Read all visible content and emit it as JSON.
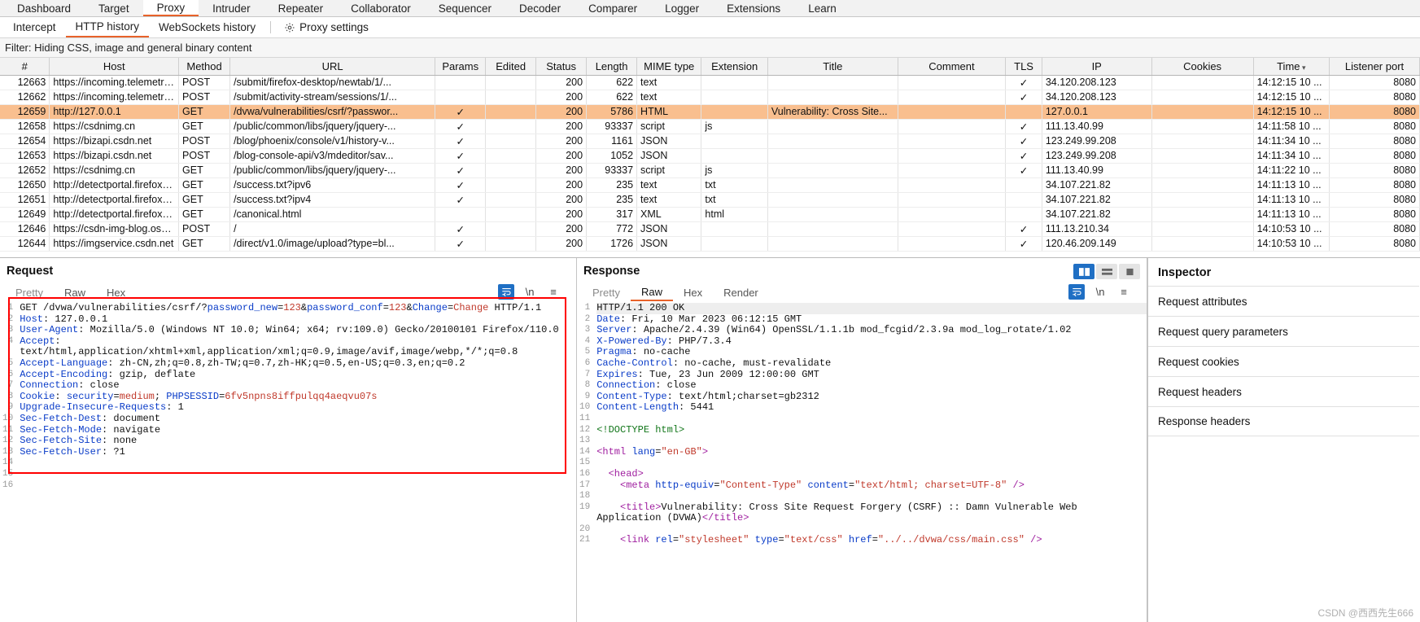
{
  "main_tabs": [
    {
      "label": "Dashboard",
      "active": false
    },
    {
      "label": "Target",
      "active": false
    },
    {
      "label": "Proxy",
      "active": true
    },
    {
      "label": "Intruder",
      "active": false
    },
    {
      "label": "Repeater",
      "active": false
    },
    {
      "label": "Collaborator",
      "active": false
    },
    {
      "label": "Sequencer",
      "active": false
    },
    {
      "label": "Decoder",
      "active": false
    },
    {
      "label": "Comparer",
      "active": false
    },
    {
      "label": "Logger",
      "active": false
    },
    {
      "label": "Extensions",
      "active": false
    },
    {
      "label": "Learn",
      "active": false
    }
  ],
  "sub_tabs": [
    {
      "label": "Intercept",
      "active": false
    },
    {
      "label": "HTTP history",
      "active": true
    },
    {
      "label": "WebSockets history",
      "active": false
    }
  ],
  "proxy_settings_label": "Proxy settings",
  "filter": {
    "text": "Filter: Hiding CSS, image and general binary content"
  },
  "table": {
    "columns": [
      "#",
      "Host",
      "Method",
      "URL",
      "Params",
      "Edited",
      "Status",
      "Length",
      "MIME type",
      "Extension",
      "Title",
      "Comment",
      "TLS",
      "IP",
      "Cookies",
      "Time",
      "Listener port"
    ],
    "sorted_column": "Time",
    "rows": [
      {
        "num": "12663",
        "host": "https://incoming.telemetry.m...",
        "method": "POST",
        "url": "/submit/firefox-desktop/newtab/1/...",
        "params": "",
        "edited": "",
        "status": "200",
        "length": "622",
        "mime": "text",
        "ext": "",
        "title": "",
        "comment": "",
        "tls": "✓",
        "ip": "34.120.208.123",
        "cookies": "",
        "time": "14:12:15 10 ...",
        "port": "8080",
        "selected": false
      },
      {
        "num": "12662",
        "host": "https://incoming.telemetry.m...",
        "method": "POST",
        "url": "/submit/activity-stream/sessions/1/...",
        "params": "",
        "edited": "",
        "status": "200",
        "length": "622",
        "mime": "text",
        "ext": "",
        "title": "",
        "comment": "",
        "tls": "✓",
        "ip": "34.120.208.123",
        "cookies": "",
        "time": "14:12:15 10 ...",
        "port": "8080",
        "selected": false
      },
      {
        "num": "12659",
        "host": "http://127.0.0.1",
        "method": "GET",
        "url": "/dvwa/vulnerabilities/csrf/?passwor...",
        "params": "✓",
        "edited": "",
        "status": "200",
        "length": "5786",
        "mime": "HTML",
        "ext": "",
        "title": "Vulnerability: Cross Site...",
        "comment": "",
        "tls": "",
        "ip": "127.0.0.1",
        "cookies": "",
        "time": "14:12:15 10 ...",
        "port": "8080",
        "selected": true
      },
      {
        "num": "12658",
        "host": "https://csdnimg.cn",
        "method": "GET",
        "url": "/public/common/libs/jquery/jquery-...",
        "params": "✓",
        "edited": "",
        "status": "200",
        "length": "93337",
        "mime": "script",
        "ext": "js",
        "title": "",
        "comment": "",
        "tls": "✓",
        "ip": "111.13.40.99",
        "cookies": "",
        "time": "14:11:58 10 ...",
        "port": "8080",
        "selected": false
      },
      {
        "num": "12654",
        "host": "https://bizapi.csdn.net",
        "method": "POST",
        "url": "/blog/phoenix/console/v1/history-v...",
        "params": "✓",
        "edited": "",
        "status": "200",
        "length": "1161",
        "mime": "JSON",
        "ext": "",
        "title": "",
        "comment": "",
        "tls": "✓",
        "ip": "123.249.99.208",
        "cookies": "",
        "time": "14:11:34 10 ...",
        "port": "8080",
        "selected": false
      },
      {
        "num": "12653",
        "host": "https://bizapi.csdn.net",
        "method": "POST",
        "url": "/blog-console-api/v3/mdeditor/sav...",
        "params": "✓",
        "edited": "",
        "status": "200",
        "length": "1052",
        "mime": "JSON",
        "ext": "",
        "title": "",
        "comment": "",
        "tls": "✓",
        "ip": "123.249.99.208",
        "cookies": "",
        "time": "14:11:34 10 ...",
        "port": "8080",
        "selected": false
      },
      {
        "num": "12652",
        "host": "https://csdnimg.cn",
        "method": "GET",
        "url": "/public/common/libs/jquery/jquery-...",
        "params": "✓",
        "edited": "",
        "status": "200",
        "length": "93337",
        "mime": "script",
        "ext": "js",
        "title": "",
        "comment": "",
        "tls": "✓",
        "ip": "111.13.40.99",
        "cookies": "",
        "time": "14:11:22 10 ...",
        "port": "8080",
        "selected": false
      },
      {
        "num": "12650",
        "host": "http://detectportal.firefox.com",
        "method": "GET",
        "url": "/success.txt?ipv6",
        "params": "✓",
        "edited": "",
        "status": "200",
        "length": "235",
        "mime": "text",
        "ext": "txt",
        "title": "",
        "comment": "",
        "tls": "",
        "ip": "34.107.221.82",
        "cookies": "",
        "time": "14:11:13 10 ...",
        "port": "8080",
        "selected": false
      },
      {
        "num": "12651",
        "host": "http://detectportal.firefox.com",
        "method": "GET",
        "url": "/success.txt?ipv4",
        "params": "✓",
        "edited": "",
        "status": "200",
        "length": "235",
        "mime": "text",
        "ext": "txt",
        "title": "",
        "comment": "",
        "tls": "",
        "ip": "34.107.221.82",
        "cookies": "",
        "time": "14:11:13 10 ...",
        "port": "8080",
        "selected": false
      },
      {
        "num": "12649",
        "host": "http://detectportal.firefox.com",
        "method": "GET",
        "url": "/canonical.html",
        "params": "",
        "edited": "",
        "status": "200",
        "length": "317",
        "mime": "XML",
        "ext": "html",
        "title": "",
        "comment": "",
        "tls": "",
        "ip": "34.107.221.82",
        "cookies": "",
        "time": "14:11:13 10 ...",
        "port": "8080",
        "selected": false
      },
      {
        "num": "12646",
        "host": "https://csdn-img-blog.oss-cn...",
        "method": "POST",
        "url": "/",
        "params": "✓",
        "edited": "",
        "status": "200",
        "length": "772",
        "mime": "JSON",
        "ext": "",
        "title": "",
        "comment": "",
        "tls": "✓",
        "ip": "111.13.210.34",
        "cookies": "",
        "time": "14:10:53 10 ...",
        "port": "8080",
        "selected": false
      },
      {
        "num": "12644",
        "host": "https://imgservice.csdn.net",
        "method": "GET",
        "url": "/direct/v1.0/image/upload?type=bl...",
        "params": "✓",
        "edited": "",
        "status": "200",
        "length": "1726",
        "mime": "JSON",
        "ext": "",
        "title": "",
        "comment": "",
        "tls": "✓",
        "ip": "120.46.209.149",
        "cookies": "",
        "time": "14:10:53 10 ...",
        "port": "8080",
        "selected": false
      }
    ]
  },
  "request": {
    "title": "Request",
    "tabs": [
      {
        "label": "Pretty",
        "active": false,
        "dim": true
      },
      {
        "label": "Raw",
        "active": false,
        "dim": false
      },
      {
        "label": "Hex",
        "active": false,
        "dim": false
      }
    ],
    "icons": {
      "wrap": "word-wrap-icon",
      "newline": "\\n",
      "menu": "≡"
    },
    "lines": [
      {
        "n": "1",
        "segs": [
          {
            "t": "GET /dvwa/vulnerabilities/csrf/?",
            "c": "v"
          },
          {
            "t": "password_new",
            "c": "k"
          },
          {
            "t": "=",
            "c": "v"
          },
          {
            "t": "123",
            "c": "str"
          },
          {
            "t": "&",
            "c": "v"
          },
          {
            "t": "password_conf",
            "c": "k"
          },
          {
            "t": "=",
            "c": "v"
          },
          {
            "t": "123",
            "c": "str"
          },
          {
            "t": "&",
            "c": "v"
          },
          {
            "t": "Change",
            "c": "k"
          },
          {
            "t": "=",
            "c": "v"
          },
          {
            "t": "Change",
            "c": "str"
          },
          {
            "t": " HTTP/1.1",
            "c": "v"
          }
        ]
      },
      {
        "n": "2",
        "segs": [
          {
            "t": "Host",
            "c": "k"
          },
          {
            "t": ": 127.0.0.1",
            "c": "v"
          }
        ]
      },
      {
        "n": "3",
        "segs": [
          {
            "t": "User-Agent",
            "c": "k"
          },
          {
            "t": ": Mozilla/5.0 (Windows NT 10.0; Win64; x64; rv:109.0) Gecko/20100101 Firefox/110.0",
            "c": "v"
          }
        ]
      },
      {
        "n": "4",
        "segs": [
          {
            "t": "Accept",
            "c": "k"
          },
          {
            "t": ":",
            "c": "v"
          }
        ]
      },
      {
        "n": "",
        "segs": [
          {
            "t": "text/html,application/xhtml+xml,application/xml;q=0.9,image/avif,image/webp,*/*;q=0.8",
            "c": "v"
          }
        ]
      },
      {
        "n": "5",
        "segs": [
          {
            "t": "Accept-Language",
            "c": "k"
          },
          {
            "t": ": zh-CN,zh;q=0.8,zh-TW;q=0.7,zh-HK;q=0.5,en-US;q=0.3,en;q=0.2",
            "c": "v"
          }
        ]
      },
      {
        "n": "6",
        "segs": [
          {
            "t": "Accept-Encoding",
            "c": "k"
          },
          {
            "t": ": gzip, deflate",
            "c": "v"
          }
        ]
      },
      {
        "n": "7",
        "segs": [
          {
            "t": "Connection",
            "c": "k"
          },
          {
            "t": ": close",
            "c": "v"
          }
        ]
      },
      {
        "n": "8",
        "segs": [
          {
            "t": "Cookie",
            "c": "k"
          },
          {
            "t": ": ",
            "c": "v"
          },
          {
            "t": "security",
            "c": "k"
          },
          {
            "t": "=",
            "c": "v"
          },
          {
            "t": "medium",
            "c": "str"
          },
          {
            "t": "; ",
            "c": "v"
          },
          {
            "t": "PHPSESSID",
            "c": "k"
          },
          {
            "t": "=",
            "c": "v"
          },
          {
            "t": "6fv5npns8iffpulqq4aeqvu07s",
            "c": "str"
          }
        ]
      },
      {
        "n": "9",
        "segs": [
          {
            "t": "Upgrade-Insecure-Requests",
            "c": "k"
          },
          {
            "t": ": 1",
            "c": "v"
          }
        ]
      },
      {
        "n": "10",
        "segs": [
          {
            "t": "Sec-Fetch-Dest",
            "c": "k"
          },
          {
            "t": ": document",
            "c": "v"
          }
        ]
      },
      {
        "n": "11",
        "segs": [
          {
            "t": "Sec-Fetch-Mode",
            "c": "k"
          },
          {
            "t": ": navigate",
            "c": "v"
          }
        ]
      },
      {
        "n": "12",
        "segs": [
          {
            "t": "Sec-Fetch-Site",
            "c": "k"
          },
          {
            "t": ": none",
            "c": "v"
          }
        ]
      },
      {
        "n": "13",
        "segs": [
          {
            "t": "Sec-Fetch-User",
            "c": "k"
          },
          {
            "t": ": ?1",
            "c": "v"
          }
        ]
      },
      {
        "n": "14",
        "segs": [
          {
            "t": "",
            "c": "v"
          }
        ]
      },
      {
        "n": "15",
        "segs": [
          {
            "t": "",
            "c": "v"
          }
        ]
      },
      {
        "n": "16",
        "segs": [
          {
            "t": "",
            "c": "v"
          }
        ]
      }
    ]
  },
  "response": {
    "title": "Response",
    "tabs": [
      {
        "label": "Pretty",
        "active": false,
        "dim": true
      },
      {
        "label": "Raw",
        "active": true,
        "dim": false
      },
      {
        "label": "Hex",
        "active": false,
        "dim": false
      },
      {
        "label": "Render",
        "active": false,
        "dim": false
      }
    ],
    "icons": {
      "wrap": "word-wrap-icon",
      "newline": "\\n",
      "menu": "≡"
    },
    "lines": [
      {
        "n": "1",
        "hl": true,
        "segs": [
          {
            "t": "HTTP/1.1 200 OK",
            "c": "v"
          }
        ]
      },
      {
        "n": "2",
        "segs": [
          {
            "t": "Date",
            "c": "k"
          },
          {
            "t": ": Fri, 10 Mar 2023 06:12:15 GMT",
            "c": "v"
          }
        ]
      },
      {
        "n": "3",
        "segs": [
          {
            "t": "Server",
            "c": "k"
          },
          {
            "t": ": Apache/2.4.39 (Win64) OpenSSL/1.1.1b mod_fcgid/2.3.9a mod_log_rotate/1.02",
            "c": "v"
          }
        ]
      },
      {
        "n": "4",
        "segs": [
          {
            "t": "X-Powered-By",
            "c": "k"
          },
          {
            "t": ": PHP/7.3.4",
            "c": "v"
          }
        ]
      },
      {
        "n": "5",
        "segs": [
          {
            "t": "Pragma",
            "c": "k"
          },
          {
            "t": ": no-cache",
            "c": "v"
          }
        ]
      },
      {
        "n": "6",
        "segs": [
          {
            "t": "Cache-Control",
            "c": "k"
          },
          {
            "t": ": no-cache, must-revalidate",
            "c": "v"
          }
        ]
      },
      {
        "n": "7",
        "segs": [
          {
            "t": "Expires",
            "c": "k"
          },
          {
            "t": ": Tue, 23 Jun 2009 12:00:00 GMT",
            "c": "v"
          }
        ]
      },
      {
        "n": "8",
        "segs": [
          {
            "t": "Connection",
            "c": "k"
          },
          {
            "t": ": close",
            "c": "v"
          }
        ]
      },
      {
        "n": "9",
        "segs": [
          {
            "t": "Content-Type",
            "c": "k"
          },
          {
            "t": ": text/html;charset=gb2312",
            "c": "v"
          }
        ]
      },
      {
        "n": "10",
        "segs": [
          {
            "t": "Content-Length",
            "c": "k"
          },
          {
            "t": ": 5441",
            "c": "v"
          }
        ]
      },
      {
        "n": "11",
        "segs": [
          {
            "t": "",
            "c": "v"
          }
        ]
      },
      {
        "n": "12",
        "segs": [
          {
            "t": "<!DOCTYPE html>",
            "c": "grn"
          }
        ]
      },
      {
        "n": "13",
        "segs": [
          {
            "t": "",
            "c": "v"
          }
        ]
      },
      {
        "n": "14",
        "segs": [
          {
            "t": "<html ",
            "c": "mag"
          },
          {
            "t": "lang",
            "c": "k"
          },
          {
            "t": "=",
            "c": "v"
          },
          {
            "t": "\"en-GB\"",
            "c": "str"
          },
          {
            "t": ">",
            "c": "mag"
          }
        ]
      },
      {
        "n": "15",
        "segs": [
          {
            "t": "",
            "c": "v"
          }
        ]
      },
      {
        "n": "16",
        "segs": [
          {
            "t": "  <head>",
            "c": "mag"
          }
        ]
      },
      {
        "n": "17",
        "segs": [
          {
            "t": "    <meta ",
            "c": "mag"
          },
          {
            "t": "http-equiv",
            "c": "k"
          },
          {
            "t": "=",
            "c": "v"
          },
          {
            "t": "\"Content-Type\"",
            "c": "str"
          },
          {
            "t": " ",
            "c": "v"
          },
          {
            "t": "content",
            "c": "k"
          },
          {
            "t": "=",
            "c": "v"
          },
          {
            "t": "\"text/html; charset=UTF-8\"",
            "c": "str"
          },
          {
            "t": " />",
            "c": "mag"
          }
        ]
      },
      {
        "n": "18",
        "segs": [
          {
            "t": "",
            "c": "v"
          }
        ]
      },
      {
        "n": "19",
        "segs": [
          {
            "t": "    <title>",
            "c": "mag"
          },
          {
            "t": "Vulnerability: Cross Site Request Forgery (CSRF) :: Damn Vulnerable Web",
            "c": "v"
          }
        ]
      },
      {
        "n": "",
        "segs": [
          {
            "t": "Application (DVWA)",
            "c": "v"
          },
          {
            "t": "</title>",
            "c": "mag"
          }
        ]
      },
      {
        "n": "20",
        "segs": [
          {
            "t": "",
            "c": "v"
          }
        ]
      },
      {
        "n": "21",
        "segs": [
          {
            "t": "    <link ",
            "c": "mag"
          },
          {
            "t": "rel",
            "c": "k"
          },
          {
            "t": "=",
            "c": "v"
          },
          {
            "t": "\"stylesheet\"",
            "c": "str"
          },
          {
            "t": " ",
            "c": "v"
          },
          {
            "t": "type",
            "c": "k"
          },
          {
            "t": "=",
            "c": "v"
          },
          {
            "t": "\"text/css\"",
            "c": "str"
          },
          {
            "t": " ",
            "c": "v"
          },
          {
            "t": "href",
            "c": "k"
          },
          {
            "t": "=",
            "c": "v"
          },
          {
            "t": "\"../../dvwa/css/main.css\"",
            "c": "str"
          },
          {
            "t": " />",
            "c": "mag"
          }
        ]
      }
    ]
  },
  "inspector": {
    "title": "Inspector",
    "rows": [
      {
        "label": "Request attributes"
      },
      {
        "label": "Request query parameters"
      },
      {
        "label": "Request cookies"
      },
      {
        "label": "Request headers"
      },
      {
        "label": "Response headers"
      }
    ]
  },
  "watermark": "CSDN @西西先生666"
}
